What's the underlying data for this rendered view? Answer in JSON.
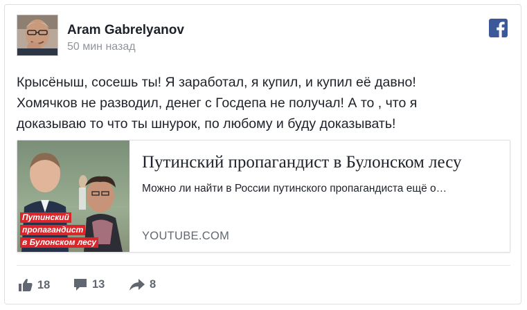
{
  "post": {
    "author": "Aram Gabrelyanov",
    "time": "50 мин назад",
    "text_lines": [
      "Крысёныш, сосешь ты! Я заработал, я купил, и купил её давно!",
      "Хомячков не разводил, денег с Госдепа не получал! А то , что я",
      "доказываю то что ты шнурок, по любому и буду доказывать!"
    ]
  },
  "link": {
    "title": "Путинский пропагандист в Булонском лесу",
    "description": "Можно ли найти в России путинского пропагандиста ещё о…",
    "domain": "YOUTUBE.COM",
    "thumbnail_caption": [
      "Путинский",
      "пропагандист",
      "в Булонском лесу"
    ]
  },
  "actions": {
    "likes": "18",
    "comments": "13",
    "shares": "8"
  },
  "icons": {
    "brand": "facebook-icon",
    "like": "thumbs-up-icon",
    "comment": "comment-icon",
    "share": "share-arrow-icon"
  },
  "colors": {
    "facebook_blue": "#3b5998",
    "meta_gray": "#90949c",
    "thumb_caption_red": "#d9262b"
  }
}
